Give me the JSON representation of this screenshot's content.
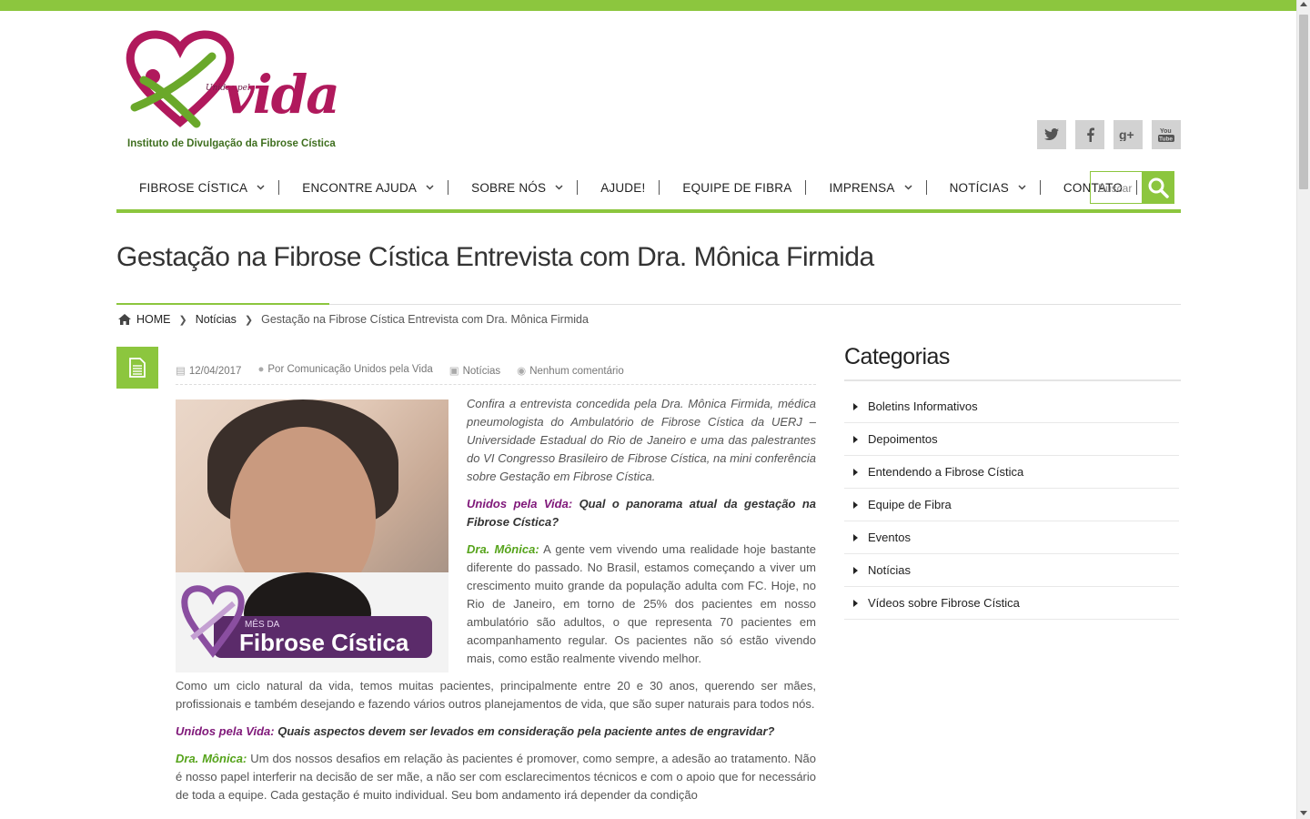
{
  "header": {
    "logo_script": "Unidos pela",
    "logo_main": "vida",
    "logo_subtitle": "Instituto de Divulgação da Fibrose Cística",
    "social": [
      {
        "icon": "twitter-icon",
        "glyph": "t"
      },
      {
        "icon": "facebook-icon",
        "glyph": "f"
      },
      {
        "icon": "google-plus-icon",
        "glyph": "g+"
      },
      {
        "icon": "youtube-icon",
        "glyph": "You\nTube"
      }
    ]
  },
  "nav": {
    "items": [
      {
        "label": "FIBROSE CÍSTICA",
        "has_caret": true
      },
      {
        "label": "ENCONTRE AJUDA",
        "has_caret": true
      },
      {
        "label": "SOBRE NÓS",
        "has_caret": true
      },
      {
        "label": "AJUDE!",
        "has_caret": false
      },
      {
        "label": "EQUIPE DE FIBRA",
        "has_caret": false
      },
      {
        "label": "IMPRENSA",
        "has_caret": true
      },
      {
        "label": "NOTÍCIAS",
        "has_caret": true
      },
      {
        "label": "CONTATO",
        "has_caret": false
      }
    ],
    "search_placeholder": "Buscar"
  },
  "page": {
    "title": "Gestação na Fibrose Cística Entrevista com Dra. Mônica Firmida"
  },
  "breadcrumb": {
    "home": "HOME",
    "section": "Notícias",
    "current": "Gestação na Fibrose Cística Entrevista com Dra. Mônica Firmida"
  },
  "post": {
    "date": "12/04/2017",
    "author": "Por Comunicação Unidos pela Vida",
    "category": "Notícias",
    "comments": "Nenhum comentário",
    "image_banner_sub": "MÊS DA",
    "image_banner_main": "Fibrose Cística",
    "intro": "Confira a entrevista concedida pela Dra. Mônica Firmida, médica pneumologista do Ambulatório de Fibrose Cística da UERJ – Universidade Estadual do Rio de Janeiro e uma das palestrantes do VI Congresso Brasileiro de Fibrose Cística, na mini conferência sobre Gestação em Fibrose Cística.",
    "q1_label": "Unidos pela Vida:",
    "q1_text": " Qual o panorama atual da gestação na Fibrose Cística?",
    "a1_label": "Dra. Mônica:",
    "a1_text": " A gente vem vivendo uma realidade hoje bastante diferente do passado. No Brasil, estamos começando a viver um crescimento muito grande da população adulta com FC. Hoje, no Rio de Janeiro, em torno de 25% dos pacientes em nosso ambulatório são adultos, o que representa 70 pacientes em acompanhamento regular. Os pacientes não só estão vivendo mais, como estão realmente vivendo melhor.",
    "p2": "Como um ciclo natural da vida, temos muitas pacientes, principalmente entre 20 e 30 anos, querendo ser mães, profissionais e também desejando e fazendo vários outros planejamentos de vida, que são super naturais para todos nós.",
    "q2_label": "Unidos pela Vida:",
    "q2_text": " Quais aspectos devem ser levados em consideração pela paciente antes de engravidar?",
    "a2_label": "Dra. Mônica:",
    "a2_text": " Um dos nossos desafios em relação às pacientes é promover, como sempre, a adesão ao tratamento. Não é nosso papel interferir na decisão de ser mãe, a não ser com esclarecimentos técnicos e com o apoio que for necessário de toda a equipe. Cada gestação é muito individual. Seu bom andamento irá depender da condição"
  },
  "sidebar": {
    "title": "Categorias",
    "categories": [
      "Boletins Informativos",
      "Depoimentos",
      "Entendendo a Fibrose Cística",
      "Equipe de Fibra",
      "Eventos",
      "Notícias",
      "Vídeos sobre Fibrose Cística"
    ]
  },
  "colors": {
    "accent_green": "#8cc63e",
    "question_purple": "#80197a",
    "answer_green": "#55a31a",
    "logo_magenta": "#b0195c"
  }
}
